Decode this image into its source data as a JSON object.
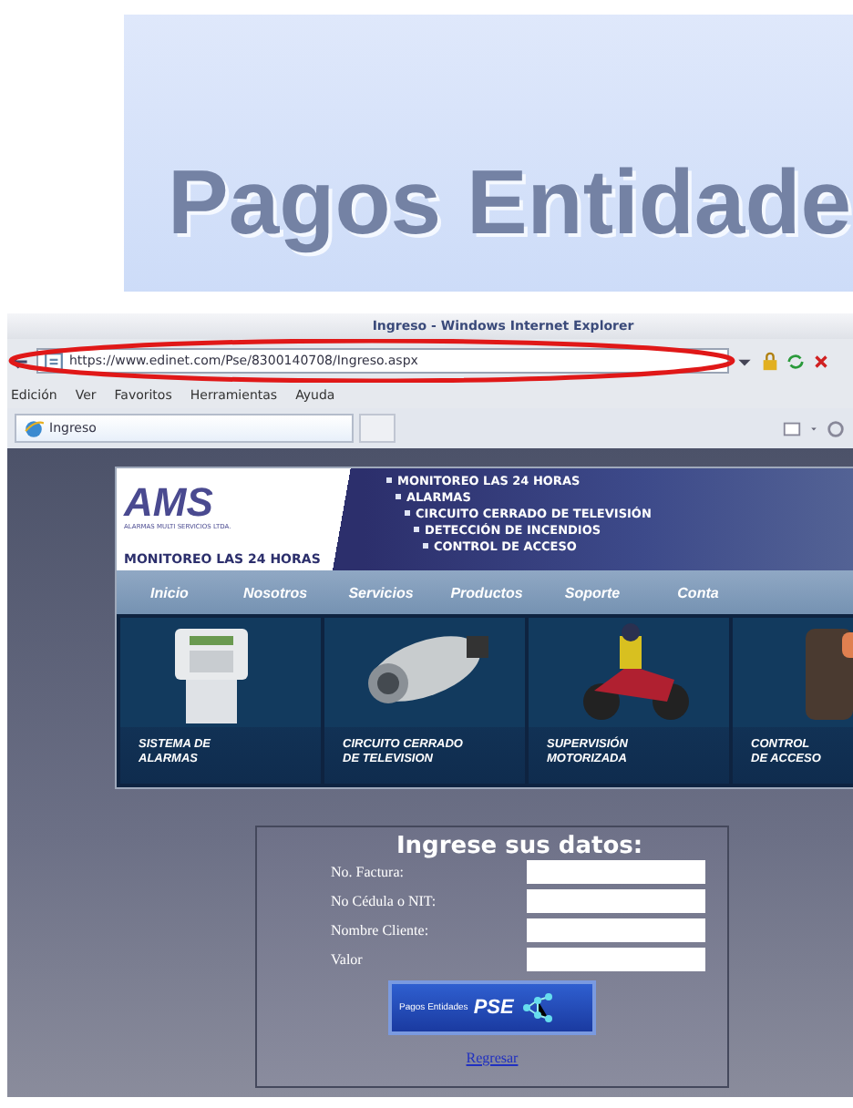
{
  "banner": {
    "title": "Pagos Entidade"
  },
  "window": {
    "title": "Ingreso - Windows Internet Explorer"
  },
  "address_bar": {
    "url": "https://www.edinet.com/Pse/8300140708/Ingreso.aspx"
  },
  "menu": [
    "Edición",
    "Ver",
    "Favoritos",
    "Herramientas",
    "Ayuda"
  ],
  "tabs": [
    {
      "label": "Ingreso",
      "selected": true
    }
  ],
  "site": {
    "logo": "AMS",
    "logo_subtitle": "ALARMAS MULTI SERVICIOS LTDA.",
    "slogan": "MONITOREO LAS 24 HORAS",
    "services": [
      "MONITOREO LAS 24 HORAS",
      "ALARMAS",
      "CIRCUITO CERRADO DE TELEVISIÓN",
      "DETECCIÓN DE INCENDIOS",
      "CONTROL DE ACCESO"
    ],
    "nav": [
      "Inicio",
      "Nosotros",
      "Servicios",
      "Productos",
      "Soporte",
      "Conta"
    ],
    "products": [
      {
        "label": "SISTEMA DE\nALARMAS",
        "kind": "alarm"
      },
      {
        "label": "CIRCUITO CERRADO\nDE TELEVISION",
        "kind": "camera"
      },
      {
        "label": "SUPERVISIÓN\nMOTORIZADA",
        "kind": "motorcycle"
      },
      {
        "label": "CONTROL\nDE ACCESO",
        "kind": "reader"
      }
    ]
  },
  "form": {
    "title": "Ingrese sus datos:",
    "fields": [
      "No. Factura:",
      "No Cédula o NIT:",
      "Nombre Cliente:",
      "Valor"
    ],
    "pay_button": {
      "label": "Pagos Entidades",
      "brand": "PSE"
    },
    "link": "Regresar"
  }
}
